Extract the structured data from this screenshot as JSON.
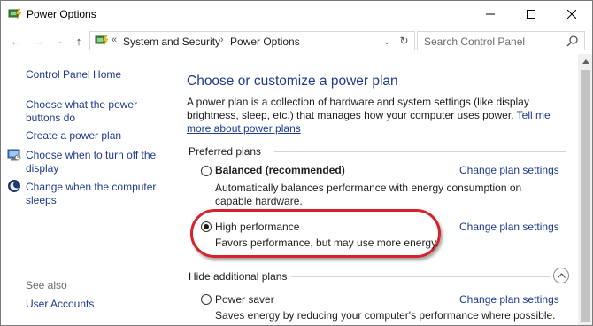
{
  "window": {
    "title": "Power Options",
    "minimize_label": "─",
    "maximize_label": "☐",
    "close_label": "✕"
  },
  "navigation": {
    "back_glyph": "←",
    "forward_glyph": "→",
    "recent_glyph": "⌄",
    "up_glyph": "↑",
    "address": {
      "overflow": "«",
      "segments": [
        "System and Security",
        "Power Options"
      ],
      "separator": "›",
      "dropdown_glyph": "⌄",
      "refresh_glyph": "↻"
    },
    "search": {
      "placeholder": "Search Control Panel"
    }
  },
  "help": {
    "label": "?"
  },
  "left_pane": {
    "home": "Control Panel Home",
    "tasks": [
      {
        "label": "Choose what the power buttons do",
        "icon": "none"
      },
      {
        "label": "Create a power plan",
        "icon": "none"
      },
      {
        "label": "Choose when to turn off the display",
        "icon": "monitor-icon"
      },
      {
        "label": "Change when the computer sleeps",
        "icon": "moon-icon"
      }
    ],
    "see_also_label": "See also",
    "see_also": [
      {
        "label": "User Accounts"
      }
    ]
  },
  "main": {
    "title": "Choose or customize a power plan",
    "description": "A power plan is a collection of hardware and system settings (like display brightness, sleep, etc.) that manages how your computer uses power.",
    "description_link": "Tell me more about power plans",
    "preferred_label": "Preferred plans",
    "hide_label": "Hide additional plans",
    "change_settings_label": "Change plan settings",
    "plans": [
      {
        "name": "Balanced (recommended)",
        "description": "Automatically balances performance with energy consumption on capable hardware.",
        "selected": false,
        "bold": true
      },
      {
        "name": "High performance",
        "description": "Favors performance, but may use more energy.",
        "selected": true,
        "bold": false
      },
      {
        "name": "Power saver",
        "description": "Saves energy by reducing your computer's performance where possible.",
        "selected": false,
        "bold": false
      }
    ]
  },
  "colors": {
    "link": "#1e3b8f",
    "highlight": "#d6232b",
    "help": "#1f6fd0"
  }
}
